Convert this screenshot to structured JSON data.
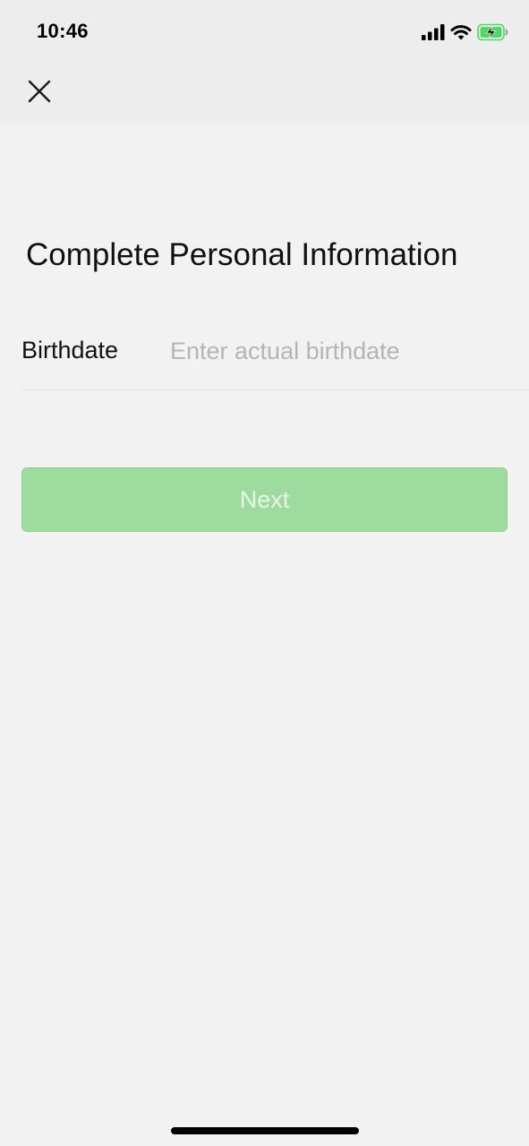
{
  "status_bar": {
    "time": "10:46",
    "icons": [
      "signal-icon",
      "wifi-icon",
      "battery-charging-icon"
    ],
    "battery_color": "#4cd964"
  },
  "header": {
    "close_icon": "close-icon"
  },
  "main": {
    "title": "Complete Personal Information",
    "birthdate": {
      "label": "Birthdate",
      "value": "",
      "placeholder": "Enter actual birthdate"
    },
    "next_button": {
      "label": "Next",
      "color": "#9edb9e",
      "enabled": false
    }
  }
}
